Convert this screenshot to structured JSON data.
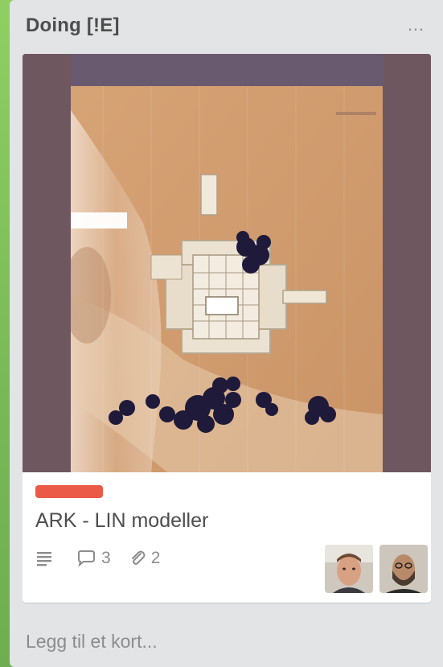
{
  "list": {
    "title": "Doing [!E]",
    "menu_glyph": "…"
  },
  "card": {
    "label_color": "#eb5a46",
    "title": "ARK - LIN modeller",
    "badges": {
      "description_icon": "description-icon",
      "comments_icon": "comment-icon",
      "comments_count": "3",
      "attachments_icon": "attachment-icon",
      "attachments_count": "2"
    },
    "members": [
      {
        "icon": "member-avatar"
      },
      {
        "icon": "member-avatar"
      }
    ]
  },
  "composer": {
    "add_card_label": "Legg til et kort..."
  }
}
